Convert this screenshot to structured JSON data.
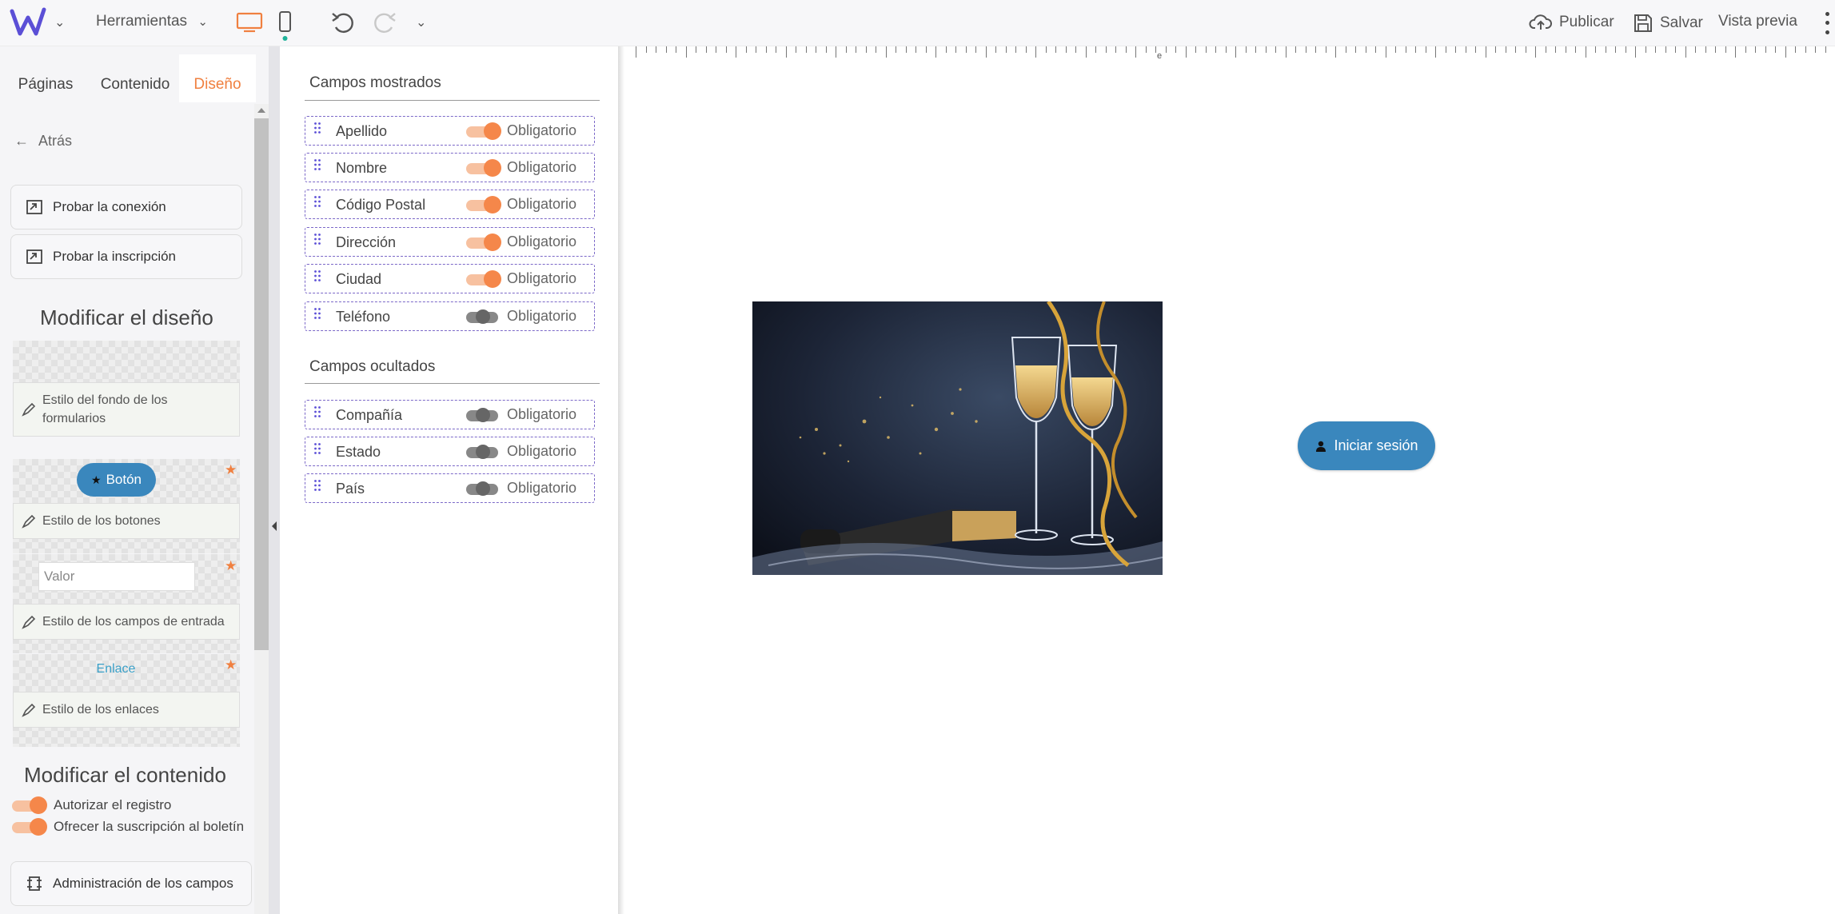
{
  "topbar": {
    "tools_label": "Herramientas",
    "publish_label": "Publicar",
    "save_label": "Salvar",
    "preview_label": "Vista previa",
    "accent_color": "#f08040"
  },
  "tabs": [
    "Páginas",
    "Contenido",
    "Diseño"
  ],
  "active_tab": "Diseño",
  "back_label": "Atrás",
  "test_connection_label": "Probar la conexión",
  "test_signup_label": "Probar la inscripción",
  "design_section": {
    "title": "Modificar el diseño",
    "form_bg_style_label": "Estilo del fondo de los formularios",
    "button_preview_label": "Botón",
    "button_style_label": "Estilo de los botones",
    "input_preview_placeholder": "Valor",
    "input_style_label": "Estilo de los campos de entrada",
    "link_preview_label": "Enlace",
    "link_style_label": "Estilo de los enlaces"
  },
  "content_section": {
    "title": "Modificar el contenido",
    "toggles": [
      {
        "label": "Autorizar el registro",
        "on": true
      },
      {
        "label": "Ofrecer la suscripción al boletín",
        "on": true
      }
    ],
    "admin_fields_label": "Administración de los campos"
  },
  "shown_fields": {
    "title": "Campos mostrados",
    "required_label": "Obligatorio",
    "items": [
      {
        "name": "Apellido",
        "required": true
      },
      {
        "name": "Nombre",
        "required": true
      },
      {
        "name": "Código Postal",
        "required": true
      },
      {
        "name": "Dirección",
        "required": true
      },
      {
        "name": "Ciudad",
        "required": true
      },
      {
        "name": "Teléfono",
        "required": false
      }
    ]
  },
  "hidden_fields": {
    "title": "Campos ocultados",
    "required_label": "Obligatorio",
    "items": [
      {
        "name": "Compañía",
        "required": false
      },
      {
        "name": "Estado",
        "required": false
      },
      {
        "name": "País",
        "required": false
      }
    ]
  },
  "canvas": {
    "ruler_marker": "e",
    "login_button_label": "Iniciar sesión",
    "button_color": "#3a87bd"
  }
}
